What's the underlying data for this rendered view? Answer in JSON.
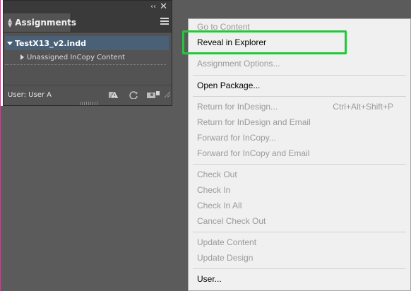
{
  "panel": {
    "tab_title": "Assignments",
    "collapse_glyph": "‹‹",
    "close_glyph": "✕",
    "document_name": "TestX13_v2.indd",
    "subitem_label": "Unassigned InCopy Content",
    "user_label": "User: User A"
  },
  "menu": {
    "items": [
      {
        "label": "Go to Content",
        "enabled": false
      },
      {
        "label": "Reveal in Explorer",
        "enabled": true
      },
      {
        "label": "Assignment Options...",
        "enabled": false
      },
      {
        "label": "Open Package...",
        "enabled": true
      },
      {
        "label": "Return for InDesign...",
        "enabled": false,
        "shortcut": "Ctrl+Alt+Shift+P"
      },
      {
        "label": "Return for InDesign and Email",
        "enabled": false
      },
      {
        "label": "Forward for InCopy...",
        "enabled": false
      },
      {
        "label": "Forward for InCopy and Email",
        "enabled": false
      },
      {
        "label": "Check Out",
        "enabled": false
      },
      {
        "label": "Check In",
        "enabled": false
      },
      {
        "label": "Check In All",
        "enabled": false
      },
      {
        "label": "Cancel Check Out",
        "enabled": false
      },
      {
        "label": "Update Content",
        "enabled": false
      },
      {
        "label": "Update Design",
        "enabled": false
      },
      {
        "label": "User...",
        "enabled": true
      }
    ]
  },
  "colors": {
    "highlight": "#22c83a",
    "selected_row": "#4a6077",
    "disabled_text": "#9a9a9a"
  }
}
